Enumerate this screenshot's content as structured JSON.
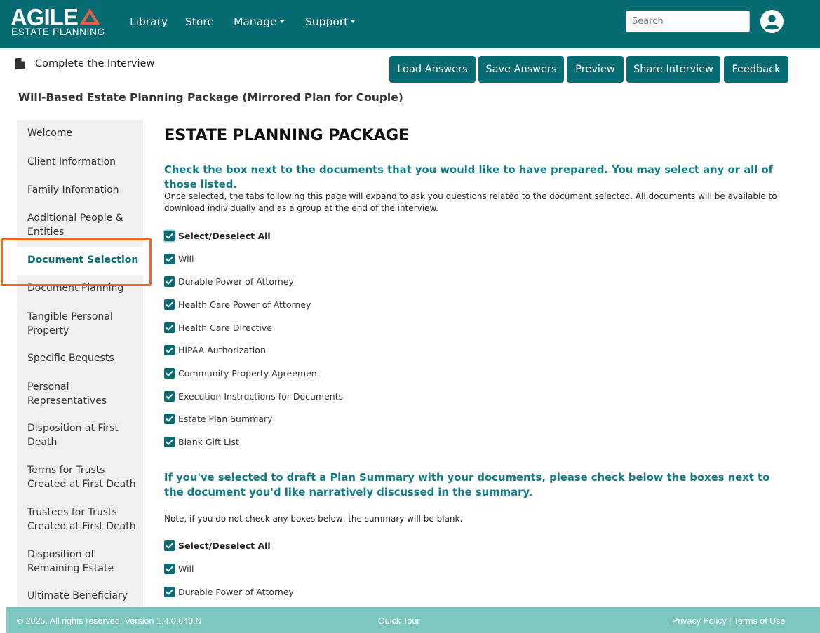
{
  "brand": {
    "logo_word": "AGILE",
    "logo_sub": "ESTATE PLANNING"
  },
  "nav": {
    "library": "Library",
    "store": "Store",
    "manage": "Manage",
    "support": "Support",
    "search_placeholder": "Search"
  },
  "header": {
    "page_label": "Complete the Interview",
    "buttons": {
      "load": "Load Answers",
      "save": "Save Answers",
      "preview": "Preview",
      "share": "Share Interview",
      "feedback": "Feedback"
    },
    "package_title": "Will-Based Estate Planning Package (Mirrored Plan for Couple)"
  },
  "sidebar": {
    "items": [
      "Welcome",
      "Client Information",
      "Family Information",
      "Additional People & Entities",
      "Document Selection",
      "Document Planning",
      "Tangible Personal Property",
      "Specific Bequests",
      "Personal Representatives",
      "Disposition at First Death",
      "Terms for Trusts Created at First Death",
      "Trustees for Trusts Created at First Death",
      "Disposition of Remaining Estate",
      "Ultimate Beneficiary"
    ],
    "active_index": 4
  },
  "main": {
    "heading": "ESTATE PLANNING PACKAGE",
    "section1": {
      "heading": "Check the box next to the documents that you would like to have prepared. You may select any or all of those listed.",
      "description": "Once selected, the tabs following this page will expand to ask you questions related to the document selected. All documents will be available to download individually and as a group at the end of the interview.",
      "select_all": {
        "label": "Select/Deselect All",
        "checked": true
      },
      "options": [
        {
          "label": "Will",
          "checked": true
        },
        {
          "label": "Durable Power of Attorney",
          "checked": true
        },
        {
          "label": "Health Care Power of Attorney",
          "checked": true
        },
        {
          "label": "Health Care Directive",
          "checked": true
        },
        {
          "label": "HIPAA Authorization",
          "checked": true
        },
        {
          "label": "Community Property Agreement",
          "checked": true
        },
        {
          "label": "Execution Instructions for Documents",
          "checked": true
        },
        {
          "label": "Estate Plan Summary",
          "checked": true
        },
        {
          "label": "Blank Gift List",
          "checked": true
        }
      ]
    },
    "section2": {
      "heading": "If you've selected to draft a Plan Summary with your documents, please check below the boxes next to the document you'd like narratively discussed in the summary.",
      "note": "Note, if you do not check any boxes below, the summary will be blank.",
      "select_all": {
        "label": "Select/Deselect All",
        "checked": true
      },
      "options": [
        {
          "label": "Will",
          "checked": true
        },
        {
          "label": "Durable Power of Attorney",
          "checked": true
        }
      ]
    }
  },
  "footer": {
    "copyright": "© 2025. All rights reserved. Version 1.4.0.640.N",
    "quick_tour": "Quick Tour",
    "privacy": "Privacy Policy",
    "separator": "|",
    "terms": "Terms of Use"
  },
  "colors": {
    "primary": "#066b73",
    "heading_teal": "#0e7b84",
    "footer_bg": "#7ec6c0",
    "highlight": "#f26522",
    "logo_red": "#e8604c"
  },
  "icons": [
    "document-icon",
    "user-avatar-icon",
    "checkmark-icon"
  ]
}
